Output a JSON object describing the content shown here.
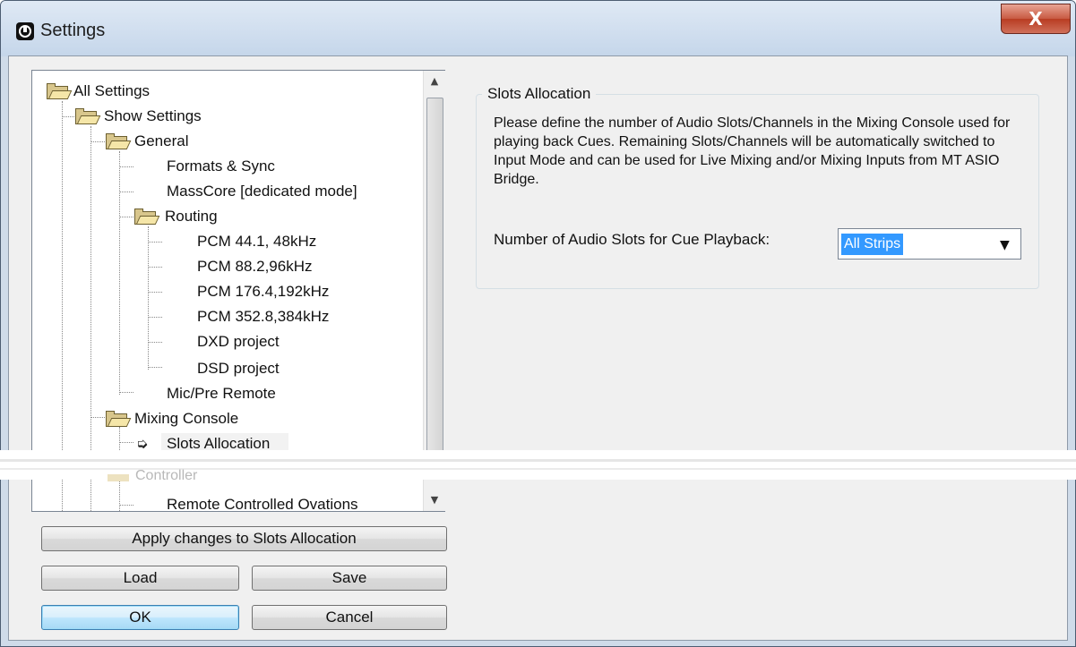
{
  "window": {
    "title": "Settings",
    "close_glyph": "X",
    "app_icon": "app-logo-icon"
  },
  "tree": {
    "items": [
      {
        "label": "All Settings",
        "icon": "folder-icon"
      },
      {
        "label": "Show Settings",
        "icon": "folder-icon"
      },
      {
        "label": "General",
        "icon": "folder-icon"
      },
      {
        "label": "Formats & Sync"
      },
      {
        "label": "MassCore [dedicated mode]"
      },
      {
        "label": "Routing",
        "icon": "folder-icon"
      },
      {
        "label": "PCM 44.1, 48kHz"
      },
      {
        "label": "PCM 88.2,96kHz"
      },
      {
        "label": "PCM 176.4,192kHz"
      },
      {
        "label": "PCM 352.8,384kHz"
      },
      {
        "label": "DXD project"
      },
      {
        "label": "DSD project"
      },
      {
        "label": "Mic/Pre Remote"
      },
      {
        "label": "Mixing Console",
        "icon": "folder-icon"
      },
      {
        "label": "Slots Allocation",
        "selected": true,
        "icon": "arrow-right-icon"
      },
      {
        "label": "Controller",
        "icon": "folder-icon"
      },
      {
        "label": "Remote Controlled Ovations"
      }
    ]
  },
  "buttons": {
    "apply": "Apply changes to Slots Allocation",
    "load": "Load",
    "save": "Save",
    "ok": "OK",
    "cancel": "Cancel"
  },
  "panel": {
    "group_title": "Slots Allocation",
    "description": "Please define the number of Audio Slots/Channels in the Mixing Console used for playing back Cues. Remaining Slots/Channels will be automatically switched to Input Mode and can be used for Live Mixing and/or Mixing Inputs from MT ASIO Bridge.",
    "field_label": "Number of Audio Slots for Cue Playback:",
    "field_value": "All Strips"
  },
  "colors": {
    "selection": "#3399ff",
    "title_gradient_top": "#dfe9f5",
    "close_red": "#c85a42"
  }
}
